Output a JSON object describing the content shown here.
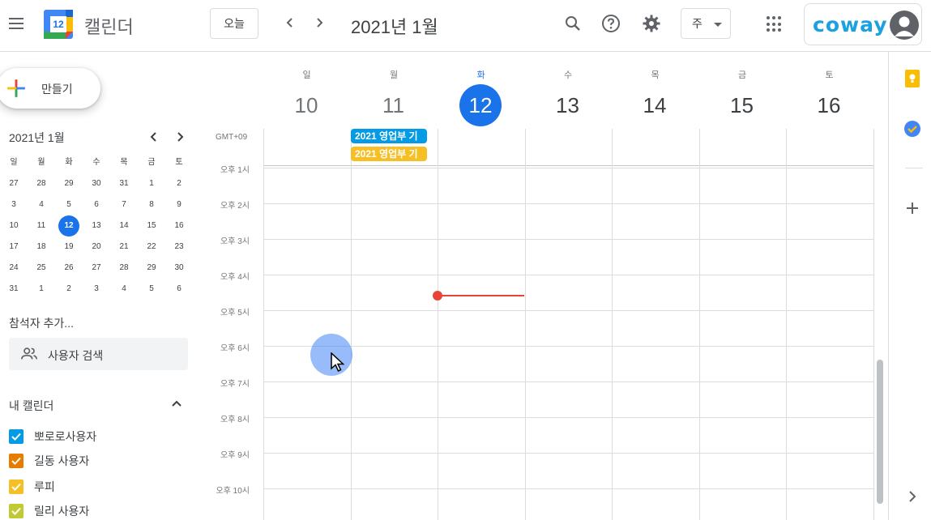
{
  "header": {
    "app_title": "캘린더",
    "logo_day": "12",
    "today_label": "오늘",
    "date_title": "2021년 1월",
    "view_label": "주",
    "brand": "coway"
  },
  "sidebar": {
    "create_label": "만들기",
    "mini_calendar": {
      "title": "2021년 1월",
      "weekdays": [
        "일",
        "월",
        "화",
        "수",
        "목",
        "금",
        "토"
      ],
      "weeks": [
        [
          "27",
          "28",
          "29",
          "30",
          "31",
          "1",
          "2"
        ],
        [
          "3",
          "4",
          "5",
          "6",
          "7",
          "8",
          "9"
        ],
        [
          "10",
          "11",
          "12",
          "13",
          "14",
          "15",
          "16"
        ],
        [
          "17",
          "18",
          "19",
          "20",
          "21",
          "22",
          "23"
        ],
        [
          "24",
          "25",
          "26",
          "27",
          "28",
          "29",
          "30"
        ],
        [
          "31",
          "1",
          "2",
          "3",
          "4",
          "5",
          "6"
        ]
      ],
      "today": "12"
    },
    "people_title": "참석자 추가...",
    "people_search": "사용자 검색",
    "my_calendars_title": "내 캘린더",
    "calendars": [
      {
        "name": "뽀로로사용자",
        "color": "#039be5"
      },
      {
        "name": "길동 사용자",
        "color": "#e67c00"
      },
      {
        "name": "루피",
        "color": "#f6bf26"
      },
      {
        "name": "릴리 사용자",
        "color": "#c0ca33"
      }
    ]
  },
  "week": {
    "days": [
      {
        "dow": "일",
        "num": "10"
      },
      {
        "dow": "월",
        "num": "11"
      },
      {
        "dow": "화",
        "num": "12"
      },
      {
        "dow": "수",
        "num": "13"
      },
      {
        "dow": "목",
        "num": "14"
      },
      {
        "dow": "금",
        "num": "15"
      },
      {
        "dow": "토",
        "num": "16"
      }
    ],
    "today_index": 2,
    "timezone": "GMT+09",
    "hours": [
      "오후 1시",
      "오후 2시",
      "오후 3시",
      "오후 4시",
      "오후 5시",
      "오후 6시",
      "오후 7시",
      "오후 8시",
      "오후 9시",
      "오후 10시"
    ],
    "events": [
      {
        "title": "2021 영업부 기",
        "color": "#039be5"
      },
      {
        "title": "2021 영업부 기",
        "color": "#f6bf26"
      }
    ]
  },
  "colors": {
    "accent": "#1a73e8",
    "now_line": "#ea4335",
    "brand": "#1ba0e0"
  },
  "icons": [
    "menu-icon",
    "calendar-logo-icon",
    "chevron-left-icon",
    "chevron-right-icon",
    "search-icon",
    "help-icon",
    "settings-icon",
    "apps-icon",
    "user-avatar-icon",
    "plus-icon",
    "people-icon",
    "chevron-up-icon",
    "check-icon",
    "keep-icon",
    "tasks-icon",
    "add-icon",
    "cursor-icon"
  ]
}
